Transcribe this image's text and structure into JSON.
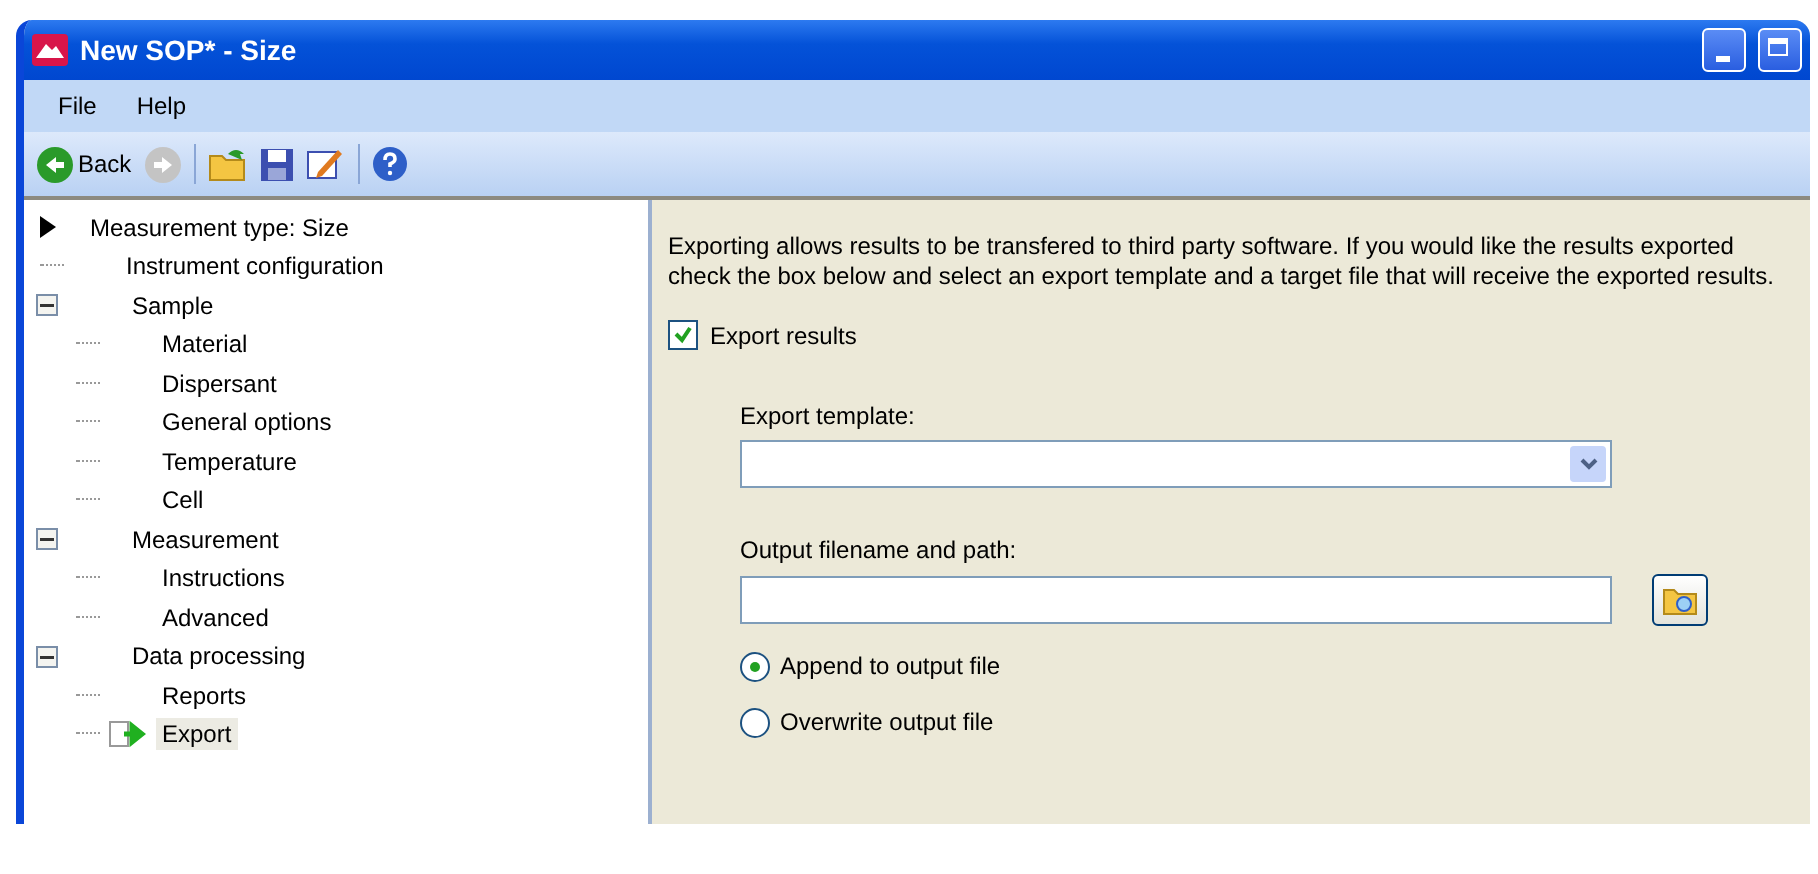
{
  "window": {
    "title": "New SOP* - Size"
  },
  "menu": [
    {
      "label": "File"
    },
    {
      "label": "Help"
    }
  ],
  "toolbar": {
    "back": {
      "label": "Back",
      "disabled": false
    },
    "forward": {
      "disabled": true
    }
  },
  "tree": {
    "root": {
      "label": "Measurement type: Size",
      "children": [
        {
          "label": "Instrument configuration",
          "selected": false
        },
        {
          "label": "Sample",
          "expanded": true,
          "selected": false,
          "children": [
            {
              "label": "Material",
              "selected": false
            },
            {
              "label": "Dispersant",
              "selected": false
            },
            {
              "label": "General options",
              "selected": false
            },
            {
              "label": "Temperature",
              "selected": false
            },
            {
              "label": "Cell",
              "selected": false
            }
          ]
        },
        {
          "label": "Measurement",
          "expanded": true,
          "selected": false,
          "children": [
            {
              "label": "Instructions",
              "selected": false
            },
            {
              "label": "Advanced",
              "selected": false
            }
          ]
        },
        {
          "label": "Data processing",
          "expanded": true,
          "selected": false,
          "children": [
            {
              "label": "Reports",
              "selected": false
            },
            {
              "label": "Export",
              "selected": true
            }
          ]
        }
      ]
    }
  },
  "panel": {
    "description": "Exporting allows results to be transfered to third party software.  If you would like the results exported check the box below and select an export template and a target file that will receive the exported results.",
    "export_checkbox": {
      "label": "Export results",
      "checked": true
    },
    "template": {
      "label": "Export template:"
    },
    "output": {
      "label": "Output filename and path:"
    },
    "radios": [
      {
        "label": "Append to output file",
        "selected": true
      },
      {
        "label": "Overwrite output file",
        "selected": false
      }
    ]
  }
}
